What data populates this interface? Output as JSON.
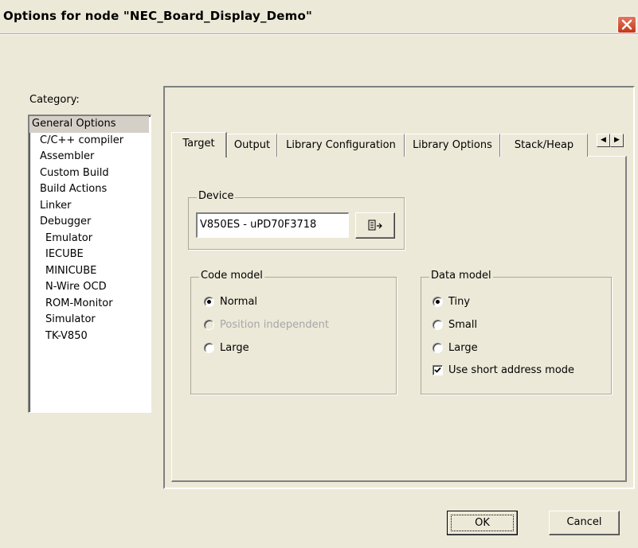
{
  "window": {
    "title": "Options for node \"NEC_Board_Display_Demo\""
  },
  "category": {
    "label": "Category:",
    "items": [
      {
        "label": "General Options",
        "level": 0,
        "selected": true
      },
      {
        "label": "C/C++ compiler",
        "level": 1
      },
      {
        "label": "Assembler",
        "level": 1
      },
      {
        "label": "Custom Build",
        "level": 1
      },
      {
        "label": "Build Actions",
        "level": 1
      },
      {
        "label": "Linker",
        "level": 1
      },
      {
        "label": "Debugger",
        "level": 1
      },
      {
        "label": "Emulator",
        "level": 2
      },
      {
        "label": "IECUBE",
        "level": 2
      },
      {
        "label": "MINICUBE",
        "level": 2
      },
      {
        "label": "N-Wire OCD",
        "level": 2
      },
      {
        "label": "ROM-Monitor",
        "level": 2
      },
      {
        "label": "Simulator",
        "level": 2
      },
      {
        "label": "TK-V850",
        "level": 2
      }
    ]
  },
  "tabs": [
    {
      "label": "Target",
      "active": true
    },
    {
      "label": "Output"
    },
    {
      "label": "Library Configuration"
    },
    {
      "label": "Library Options"
    },
    {
      "label": "Stack/Heap"
    }
  ],
  "tab_scroll": {
    "left_icon": "arrow-left-icon",
    "right_icon": "arrow-right-icon"
  },
  "device": {
    "legend": "Device",
    "value": "V850ES - uPD70F3718",
    "select_icon": "device-select-icon"
  },
  "code_model": {
    "legend": "Code model",
    "options": [
      {
        "label": "Normal",
        "checked": true,
        "disabled": false
      },
      {
        "label": "Position independent",
        "checked": false,
        "disabled": true
      },
      {
        "label": "Large",
        "checked": false,
        "disabled": false
      }
    ]
  },
  "data_model": {
    "legend": "Data model",
    "options": [
      {
        "label": "Tiny",
        "checked": true
      },
      {
        "label": "Small",
        "checked": false
      },
      {
        "label": "Large",
        "checked": false
      }
    ],
    "short_address": {
      "label": "Use short address mode",
      "checked": true
    }
  },
  "buttons": {
    "ok": "OK",
    "cancel": "Cancel"
  },
  "colors": {
    "dialog_bg": "#ece9d8",
    "close_button": "#c3381a",
    "selected_item": "#d4d0c8"
  }
}
